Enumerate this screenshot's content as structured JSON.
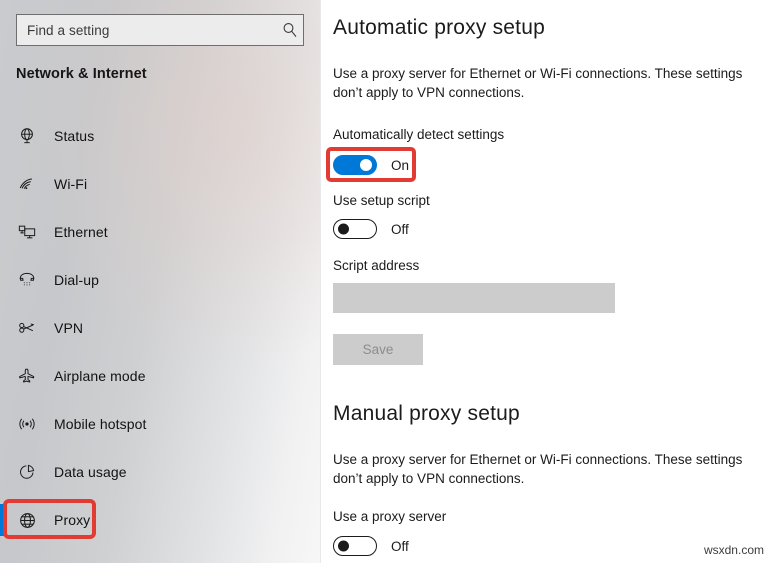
{
  "sidebar": {
    "search": {
      "placeholder": "Find a setting",
      "value": "",
      "icon": "search-icon"
    },
    "section_title": "Network & Internet",
    "items": [
      {
        "label": "Status",
        "icon": "globe-network-icon",
        "selected": false
      },
      {
        "label": "Wi-Fi",
        "icon": "wifi-icon",
        "selected": false
      },
      {
        "label": "Ethernet",
        "icon": "ethernet-icon",
        "selected": false
      },
      {
        "label": "Dial-up",
        "icon": "dialup-phone-icon",
        "selected": false
      },
      {
        "label": "VPN",
        "icon": "vpn-key-icon",
        "selected": false
      },
      {
        "label": "Airplane mode",
        "icon": "airplane-icon",
        "selected": false
      },
      {
        "label": "Mobile hotspot",
        "icon": "hotspot-signal-icon",
        "selected": false
      },
      {
        "label": "Data usage",
        "icon": "pie-chart-icon",
        "selected": false
      },
      {
        "label": "Proxy",
        "icon": "globe-icon",
        "selected": true
      }
    ]
  },
  "content": {
    "automatic": {
      "heading": "Automatic proxy setup",
      "description": "Use a proxy server for Ethernet or Wi-Fi connections. These settings don’t apply to VPN connections.",
      "detect": {
        "label": "Automatically detect settings",
        "state": "On"
      },
      "setup_script": {
        "label": "Use setup script",
        "state": "Off"
      },
      "script_address": {
        "label": "Script address",
        "value": "",
        "placeholder": ""
      },
      "save_label": "Save"
    },
    "manual": {
      "heading": "Manual proxy setup",
      "description": "Use a proxy server for Ethernet or Wi-Fi connections. These settings don’t apply to VPN connections.",
      "use_proxy": {
        "label": "Use a proxy server",
        "state": "Off"
      }
    }
  },
  "watermark": "wsxdn.com",
  "colors": {
    "accent_blue": "#0078d7",
    "annotation_red": "#e23b34",
    "disabled_gray": "#cccccc"
  }
}
